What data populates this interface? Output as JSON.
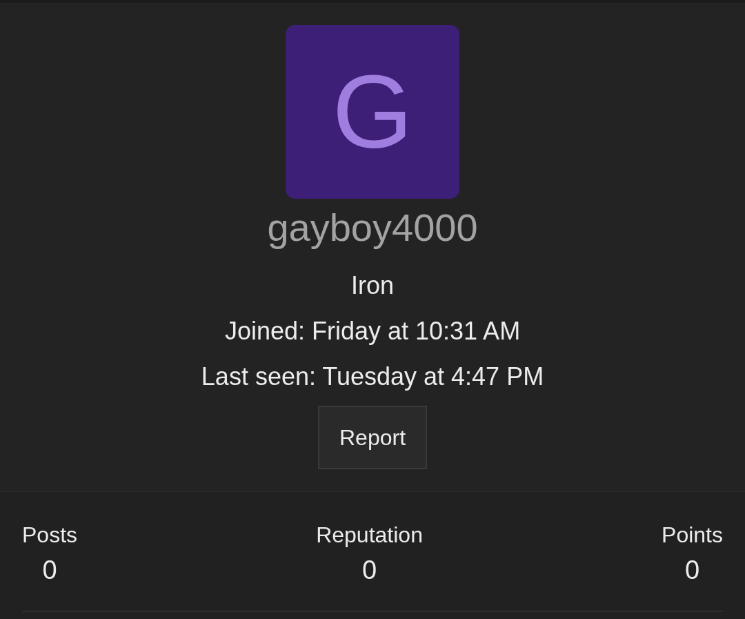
{
  "avatar": {
    "letter": "G"
  },
  "username": "gayboy4000",
  "rank": "Iron",
  "joined": "Joined: Friday at 10:31 AM",
  "last_seen": "Last seen: Tuesday at 4:47 PM",
  "report_button": "Report",
  "stats": [
    {
      "label": "Posts",
      "value": "0"
    },
    {
      "label": "Reputation",
      "value": "0"
    },
    {
      "label": "Points",
      "value": "0"
    }
  ]
}
